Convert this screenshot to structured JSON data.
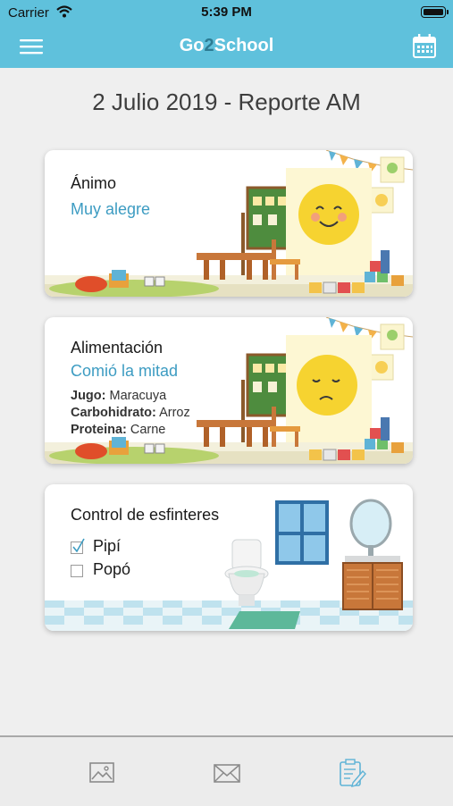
{
  "status_bar": {
    "carrier": "Carrier",
    "time": "5:39 PM"
  },
  "nav": {
    "title_part1": "Go",
    "title_part2": "2",
    "title_part3": "School",
    "menu_icon": "hamburger-menu-icon",
    "calendar_icon": "calendar-icon"
  },
  "page": {
    "heading": "2 Julio 2019 - Reporte AM"
  },
  "cards": {
    "mood": {
      "label": "Ánimo",
      "value": "Muy alegre"
    },
    "food": {
      "label": "Alimentación",
      "value": "Comió la mitad",
      "details": [
        {
          "key": "Jugo:",
          "value": " Maracuya"
        },
        {
          "key": "Carbohidrato:",
          "value": " Arroz"
        },
        {
          "key": "Proteina:",
          "value": " Carne"
        }
      ]
    },
    "bathroom": {
      "label": "Control de esfinteres",
      "options": [
        {
          "label": "Pipí",
          "checked": true
        },
        {
          "label": "Popó",
          "checked": false
        }
      ]
    }
  },
  "tabs": [
    {
      "name": "gallery-tab",
      "icon": "image-icon",
      "active": false
    },
    {
      "name": "messages-tab",
      "icon": "envelope-icon",
      "active": false
    },
    {
      "name": "reports-tab",
      "icon": "report-edit-icon",
      "active": true
    }
  ],
  "colors": {
    "accent": "#5fc1dc",
    "link_text": "#3d9cc2",
    "tab_inactive": "#8a8a8a",
    "tab_active": "#5fb3d6"
  }
}
